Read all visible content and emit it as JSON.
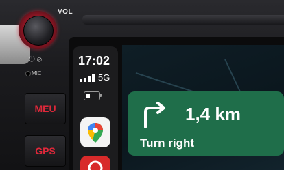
{
  "device": {
    "vol_label": "VOL",
    "mic_label": "MIC",
    "menu_button": "MEU",
    "gps_button": "GPS"
  },
  "status_bar": {
    "time": "17:02",
    "network": "5G",
    "battery_level": 0.35,
    "signal_bars": 4
  },
  "apps": [
    {
      "icon": "google-maps-icon"
    },
    {
      "icon": "red-app-icon"
    }
  ],
  "navigation": {
    "distance": "1,4 km",
    "instruction": "Turn right",
    "maneuver_icon": "turn-right-arrow-icon",
    "card_color": "#1f6e4a"
  },
  "colors": {
    "button_text": "#e0283a",
    "knob_ring": "#c92a3a"
  }
}
